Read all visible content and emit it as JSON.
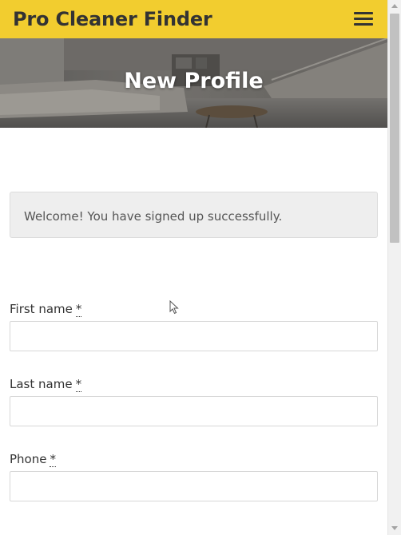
{
  "navbar": {
    "brand": "Pro Cleaner Finder",
    "menu_icon": "hamburger-menu-icon",
    "background_color": "#f2cd2f"
  },
  "hero": {
    "title": "New Profile"
  },
  "alert": {
    "message": "Welcome! You have signed up successfully."
  },
  "form": {
    "first_name": {
      "label": "First name",
      "required_mark": "*",
      "required_title": "required",
      "value": ""
    },
    "last_name": {
      "label": "Last name",
      "required_mark": "*",
      "required_title": "required",
      "value": ""
    },
    "phone": {
      "label": "Phone",
      "required_mark": "*",
      "required_title": "required",
      "value": ""
    }
  }
}
